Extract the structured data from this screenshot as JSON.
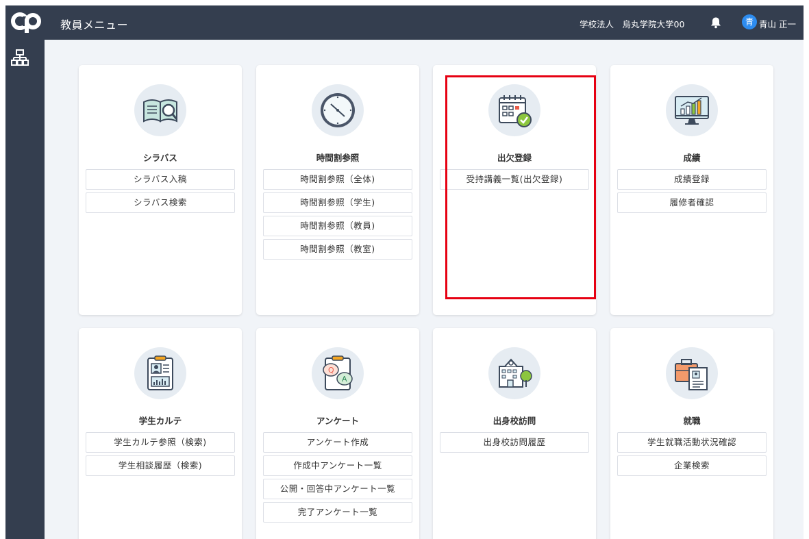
{
  "header": {
    "title": "教員メニュー",
    "school": "学校法人　烏丸学院大学00",
    "avatar_char": "青",
    "user_name": "青山 正一"
  },
  "cards": [
    {
      "title": "シラバス",
      "icon": "book-search-icon",
      "links": [
        "シラバス入稿",
        "シラバス検索"
      ]
    },
    {
      "title": "時間割参照",
      "icon": "clock-icon",
      "links": [
        "時間割参照（全体)",
        "時間割参照（学生)",
        "時間割参照（教員)",
        "時間割参照（教室)"
      ]
    },
    {
      "title": "出欠登録",
      "icon": "calendar-check-icon",
      "links": [
        "受持講義一覧(出欠登録)"
      ]
    },
    {
      "title": "成績",
      "icon": "monitor-chart-icon",
      "links": [
        "成績登録",
        "履修者確認"
      ]
    },
    {
      "title": "学生カルテ",
      "icon": "clipboard-profile-icon",
      "links": [
        "学生カルテ参照（検索)",
        "学生相談履歴（検索)"
      ]
    },
    {
      "title": "アンケート",
      "icon": "qa-clipboard-icon",
      "links": [
        "アンケート作成",
        "作成中アンケート一覧",
        "公開・回答中アンケート一覧",
        "完了アンケート一覧"
      ]
    },
    {
      "title": "出身校訪問",
      "icon": "school-building-icon",
      "links": [
        "出身校訪問履歴"
      ]
    },
    {
      "title": "就職",
      "icon": "briefcase-document-icon",
      "links": [
        "学生就職活動状況確認",
        "企業検索"
      ]
    }
  ],
  "colors": {
    "header_bg": "#343e4f",
    "page_bg": "#f1f4f8",
    "highlight": "#e60012",
    "avatar": "#2d8cf0"
  }
}
